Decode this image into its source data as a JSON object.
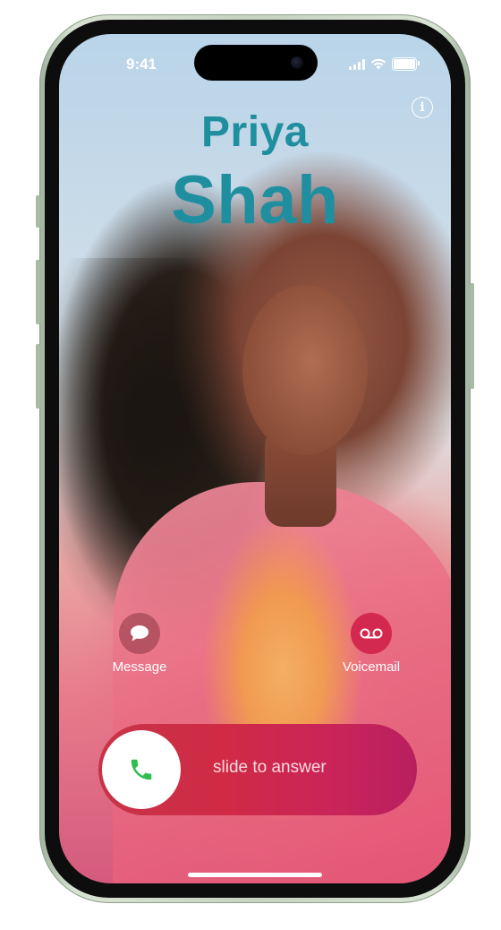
{
  "status_bar": {
    "time": "9:41",
    "icons": [
      "signal-icon",
      "wifi-icon",
      "battery-icon"
    ]
  },
  "caller": {
    "first_name": "Priya",
    "last_name": "Shah",
    "name_color": "#1f8fa0"
  },
  "actions": {
    "message_label": "Message",
    "message_icon": "message-bubble-icon",
    "voicemail_label": "Voicemail",
    "voicemail_icon": "voicemail-icon"
  },
  "slider": {
    "text": "slide to answer",
    "knob_icon": "phone-icon",
    "accent": "#d02a45",
    "phone_color": "#2fbf4f"
  },
  "info_icon": "info-icon"
}
